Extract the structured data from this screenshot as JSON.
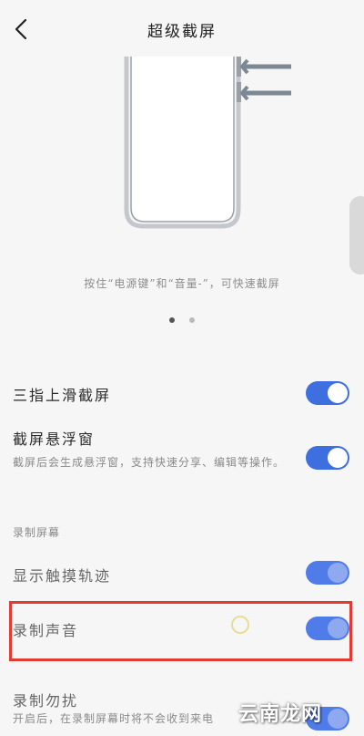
{
  "header": {
    "title": "超级截屏",
    "back_icon": "chevron-left-icon"
  },
  "illustration": {
    "caption": "按住“电源键”和“音量-”，可快速截屏",
    "arrow_icon": "arrow-left-icon"
  },
  "pager": {
    "pages": 2,
    "active_index": 0,
    "active_color": "#555555",
    "inactive_color": "#bbbbbb"
  },
  "settings": {
    "three_finger": {
      "title": "三指上滑截屏",
      "enabled": true
    },
    "floating": {
      "title": "截屏悬浮窗",
      "desc": "截屏后会生成悬浮窗，支持快速分享、编辑等操作。",
      "enabled": true
    },
    "section_label": "录制屏幕",
    "touch_trail": {
      "title": "显示触摸轨迹",
      "enabled": true
    },
    "record_sound": {
      "title": "录制声音",
      "enabled": true
    },
    "record_disturb": {
      "title": "录制勿扰",
      "desc": "开启后，在录制屏幕时将不会收到来电",
      "enabled": true
    }
  },
  "colors": {
    "accent": "#3d6fe0",
    "highlight": "#e23b34"
  },
  "watermark": "云南龙网"
}
